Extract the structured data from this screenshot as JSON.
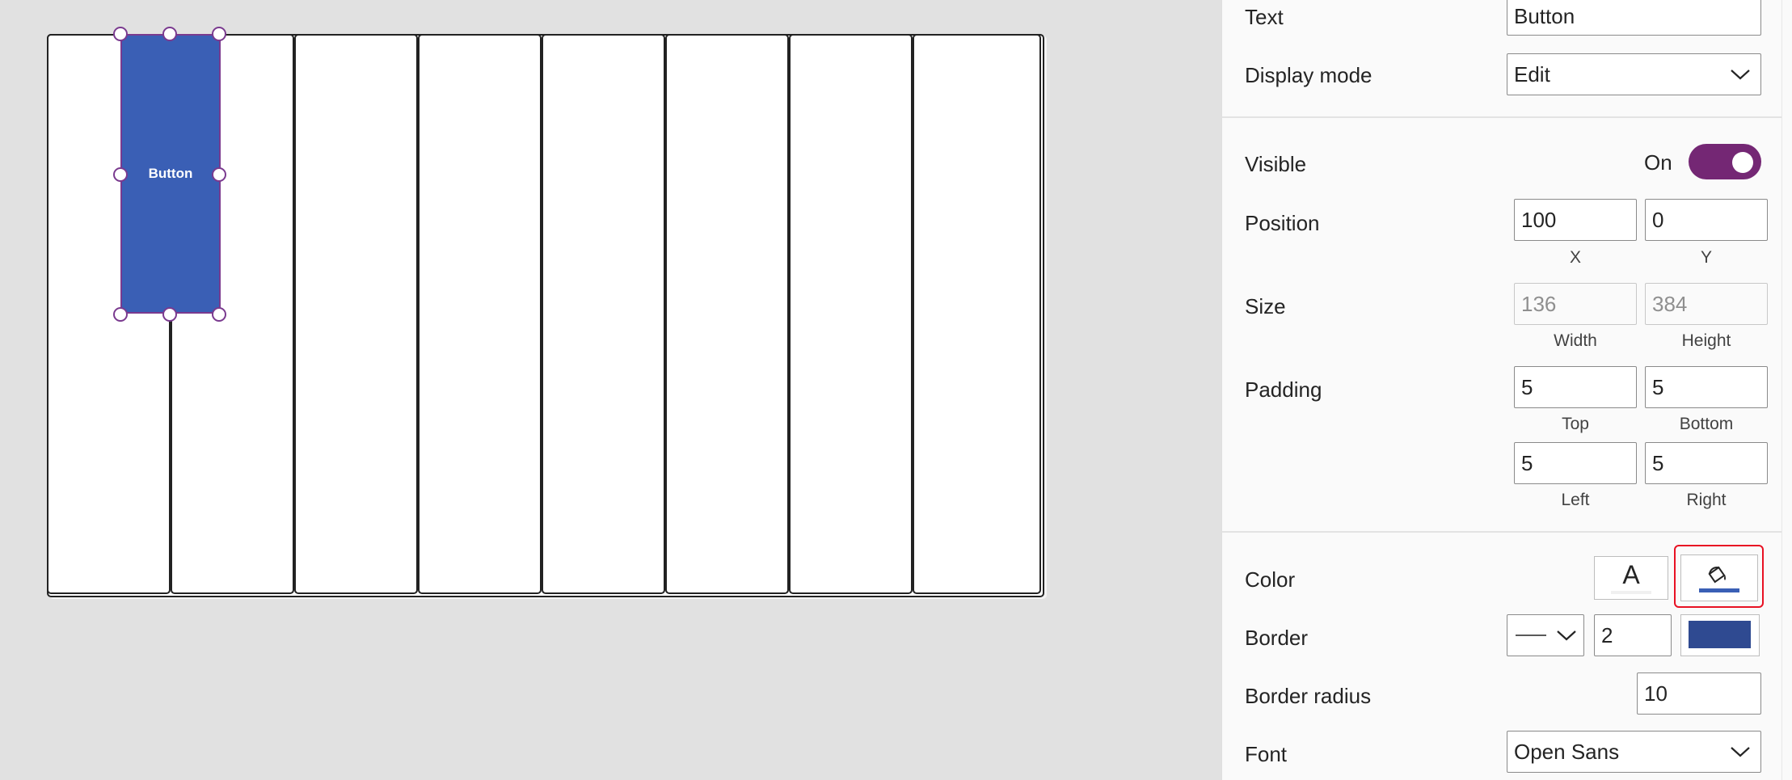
{
  "canvas": {
    "button_text": "Button",
    "key_count": 8
  },
  "properties": {
    "text": {
      "label": "Text",
      "value": "Button"
    },
    "display_mode": {
      "label": "Display mode",
      "value": "Edit"
    },
    "visible": {
      "label": "Visible",
      "state": "On",
      "on": true
    },
    "position": {
      "label": "Position",
      "x": "100",
      "y": "0",
      "x_label": "X",
      "y_label": "Y"
    },
    "size": {
      "label": "Size",
      "width": "136",
      "height": "384",
      "width_label": "Width",
      "height_label": "Height"
    },
    "padding": {
      "label": "Padding",
      "top": "5",
      "bottom": "5",
      "left": "5",
      "right": "5",
      "top_label": "Top",
      "bottom_label": "Bottom",
      "left_label": "Left",
      "right_label": "Right"
    },
    "color": {
      "label": "Color",
      "text_glyph": "A"
    },
    "border": {
      "label": "Border",
      "thickness": "2"
    },
    "border_radius": {
      "label": "Border radius",
      "value": "10"
    },
    "font": {
      "label": "Font",
      "value": "Open Sans"
    }
  },
  "colors": {
    "button_fill": "#3a5fb5",
    "selection": "#7a3a8f",
    "toggle_on": "#742774",
    "border_color": "#2f4a91",
    "highlight": "#e81123"
  },
  "icons": {
    "fill": "paint-bucket-icon",
    "text_color": "font-color-icon",
    "dropdown": "chevron-down-icon",
    "line_style": "solid-line-icon"
  }
}
